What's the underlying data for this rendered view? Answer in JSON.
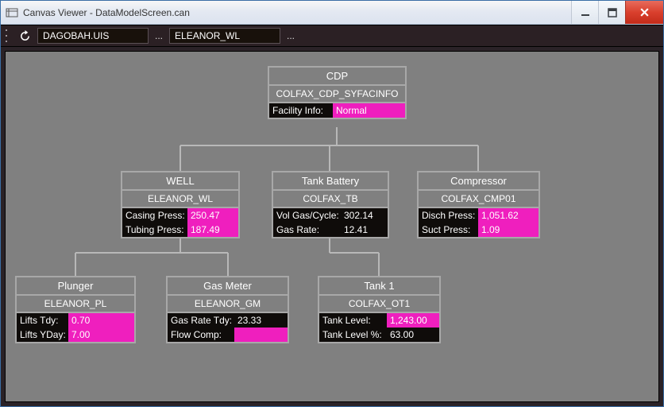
{
  "window": {
    "title": "Canvas Viewer - DataModelScreen.can"
  },
  "toolbar": {
    "path1": "DAGOBAH.UIS",
    "path2": "ELEANOR_WL"
  },
  "nodes": {
    "cdp": {
      "title": "CDP",
      "sub": "COLFAX_CDP_SYFACINFO",
      "rows": [
        {
          "label": "Facility Info:",
          "value": "Normal",
          "pink": true
        }
      ]
    },
    "well": {
      "title": "WELL",
      "sub": "ELEANOR_WL",
      "rows": [
        {
          "label": "Casing Press:",
          "value": "250.47",
          "pink": true
        },
        {
          "label": "Tubing Press:",
          "value": "187.49",
          "pink": true
        }
      ]
    },
    "tankbat": {
      "title": "Tank Battery",
      "sub": "COLFAX_TB",
      "rows": [
        {
          "label": "Vol Gas/Cycle:",
          "value": "302.14",
          "pink": false
        },
        {
          "label": "Gas Rate:",
          "value": "12.41",
          "pink": false
        }
      ]
    },
    "comp": {
      "title": "Compressor",
      "sub": "COLFAX_CMP01",
      "rows": [
        {
          "label": "Disch Press:",
          "value": "1,051.62",
          "pink": true
        },
        {
          "label": "Suct Press:",
          "value": "1.09",
          "pink": true
        }
      ]
    },
    "plunger": {
      "title": "Plunger",
      "sub": "ELEANOR_PL",
      "rows": [
        {
          "label": "Lifts Tdy:",
          "value": "0.70",
          "pink": true
        },
        {
          "label": "Lifts YDay:",
          "value": "7.00",
          "pink": true
        }
      ]
    },
    "gasmeter": {
      "title": "Gas Meter",
      "sub": "ELEANOR_GM",
      "rows": [
        {
          "label": "Gas Rate Tdy:",
          "value": "23.33",
          "pink": false
        },
        {
          "label": "Flow Comp:",
          "value": "",
          "pink": true
        }
      ]
    },
    "tank1": {
      "title": "Tank 1",
      "sub": "COLFAX_OT1",
      "rows": [
        {
          "label": "Tank Level:",
          "value": "1,243.00",
          "pink": true
        },
        {
          "label": "Tank Level %:",
          "value": "63.00",
          "pink": false
        }
      ]
    }
  }
}
